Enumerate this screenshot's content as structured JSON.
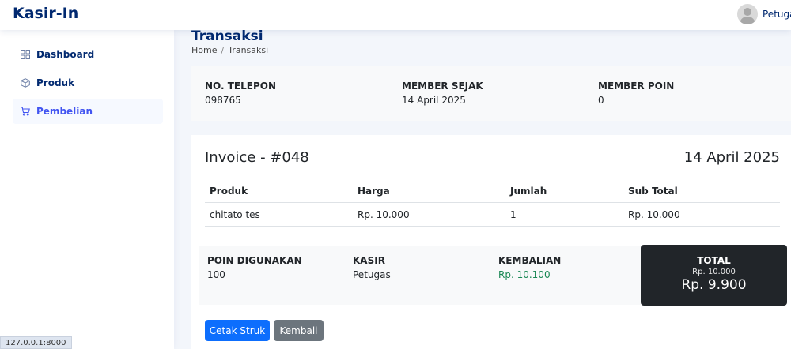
{
  "app": {
    "brand": "Kasir-In",
    "user_name": "Petugas"
  },
  "sidebar": {
    "items": [
      {
        "label": "Dashboard",
        "icon": "grid-icon",
        "active": false
      },
      {
        "label": "Produk",
        "icon": "box-icon",
        "active": false
      },
      {
        "label": "Pembelian",
        "icon": "cart-icon",
        "active": true
      }
    ]
  },
  "page": {
    "title": "Transaksi",
    "breadcrumb": [
      "Home",
      "/",
      "Transaksi"
    ]
  },
  "member": {
    "phone_label": "NO. TELEPON",
    "phone": "098765",
    "since_label": "MEMBER SEJAK",
    "since": "14 April 2025",
    "points_label": "MEMBER POIN",
    "points": "0"
  },
  "invoice": {
    "title": "Invoice - #048",
    "date": "14 April 2025",
    "columns": [
      "Produk",
      "Harga",
      "Jumlah",
      "Sub Total"
    ],
    "rows": [
      [
        "chitato tes",
        "Rp. 10.000",
        "1",
        "Rp. 10.000"
      ]
    ]
  },
  "summary": {
    "points_used_label": "POIN DIGUNAKAN",
    "points_used": "100",
    "cashier_label": "KASIR",
    "cashier": "Petugas",
    "change_label": "KEMBALIAN",
    "change": "Rp. 10.100",
    "total_label": "TOTAL",
    "total_before": "Rp. 10.000",
    "total_after": "Rp. 9.900"
  },
  "actions": {
    "print_label": "Cetak Struk",
    "back_label": "Kembali"
  },
  "status_bar": {
    "url": "127.0.0.1:8000"
  },
  "colors": {
    "brand": "#012970",
    "accent": "#4154f1",
    "primary_button": "#0d6efd",
    "secondary_button": "#6c757d",
    "change_text": "#198754",
    "total_bg": "#212529"
  }
}
